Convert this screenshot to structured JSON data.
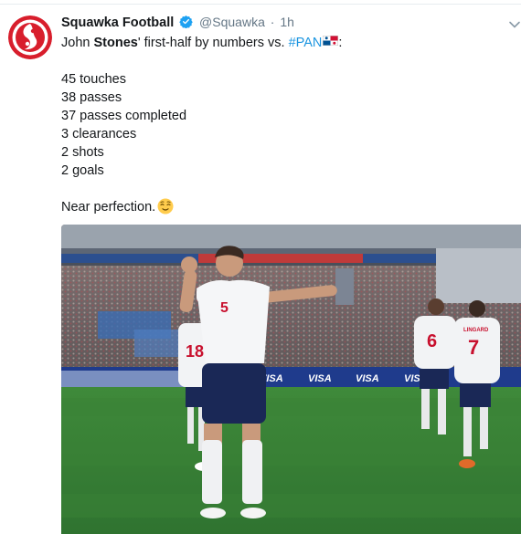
{
  "tweet": {
    "author_name": "Squawka Football",
    "handle": "@Squawka",
    "separator": "·",
    "time": "1h",
    "intro": {
      "prefix": "John ",
      "bold": "Stones",
      "middle": "' first-half by numbers vs. ",
      "hashtag": "#PAN",
      "suffix": ":"
    },
    "stats": [
      "45 touches",
      "38 passes",
      "37 passes completed",
      "3 clearances",
      "2 shots",
      "2 goals"
    ],
    "closing": "Near perfection.",
    "icons": {
      "verified": "verified-badge-icon",
      "caret": "chevron-down-icon",
      "flag": "panama-flag-icon",
      "emoji": "relieved-face-emoji-icon"
    },
    "colors": {
      "brand_red": "#d81e2c",
      "link_blue": "#1b95e0",
      "muted": "#657786"
    }
  },
  "media": {
    "shirt_numbers": [
      "5",
      "18",
      "6",
      "7"
    ],
    "shirt_name": "LINGARD",
    "ad_boards": [
      "VISA",
      "VISA",
      "VISA",
      "VISA"
    ]
  }
}
